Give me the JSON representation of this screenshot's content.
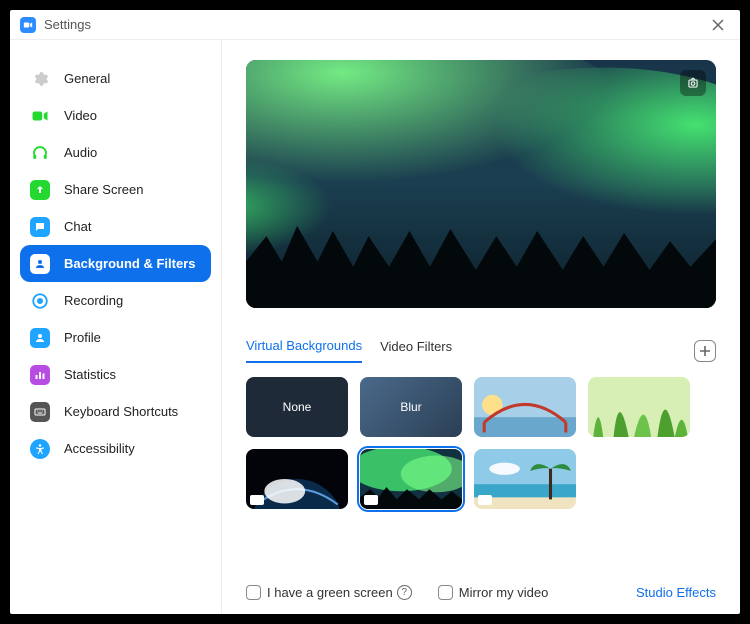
{
  "window": {
    "title": "Settings"
  },
  "sidebar": {
    "items": [
      {
        "id": "general",
        "label": "General"
      },
      {
        "id": "video",
        "label": "Video"
      },
      {
        "id": "audio",
        "label": "Audio"
      },
      {
        "id": "share-screen",
        "label": "Share Screen"
      },
      {
        "id": "chat",
        "label": "Chat"
      },
      {
        "id": "bg-filters",
        "label": "Background & Filters"
      },
      {
        "id": "recording",
        "label": "Recording"
      },
      {
        "id": "profile",
        "label": "Profile"
      },
      {
        "id": "statistics",
        "label": "Statistics"
      },
      {
        "id": "keyboard",
        "label": "Keyboard Shortcuts"
      },
      {
        "id": "accessibility",
        "label": "Accessibility"
      }
    ],
    "active_id": "bg-filters"
  },
  "tabs": {
    "items": [
      {
        "id": "virtual-backgrounds",
        "label": "Virtual Backgrounds"
      },
      {
        "id": "video-filters",
        "label": "Video Filters"
      }
    ],
    "active_id": "virtual-backgrounds"
  },
  "backgrounds": {
    "none_label": "None",
    "blur_label": "Blur",
    "selected_id": "aurora",
    "items": [
      {
        "id": "none",
        "type": "none"
      },
      {
        "id": "blur",
        "type": "blur"
      },
      {
        "id": "bridge",
        "type": "image"
      },
      {
        "id": "grass",
        "type": "image"
      },
      {
        "id": "earth",
        "type": "video"
      },
      {
        "id": "aurora",
        "type": "video"
      },
      {
        "id": "beach",
        "type": "video"
      }
    ]
  },
  "options": {
    "green_screen_label": "I have a green screen",
    "green_screen_checked": false,
    "mirror_label": "Mirror my video",
    "mirror_checked": false,
    "studio_effects_label": "Studio Effects"
  }
}
